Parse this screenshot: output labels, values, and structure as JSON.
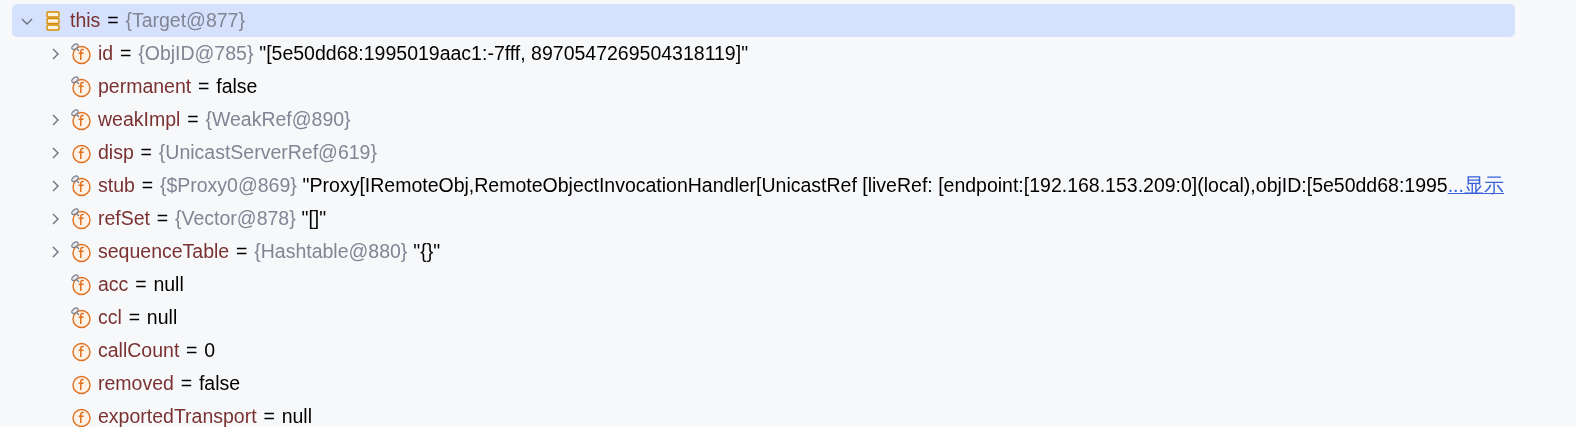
{
  "tree": {
    "name": "this",
    "eq": "=",
    "type": "{Target@877}",
    "kind": "object",
    "expanded": true,
    "selected": true,
    "children": [
      {
        "name": "id",
        "type": "{ObjID@785}",
        "value": "\"[5e50dd68:1995019aac1:-7fff, 8970547269504318119]\"",
        "kind": "field",
        "final": true,
        "expandable": true,
        "expanded": false
      },
      {
        "name": "permanent",
        "value": "false",
        "kind": "field",
        "final": true,
        "expandable": false
      },
      {
        "name": "weakImpl",
        "type": "{WeakRef@890}",
        "kind": "field",
        "final": true,
        "expandable": true,
        "expanded": false
      },
      {
        "name": "disp",
        "type": "{UnicastServerRef@619}",
        "kind": "field",
        "final": false,
        "expandable": true,
        "expanded": false
      },
      {
        "name": "stub",
        "type": "{$Proxy0@869}",
        "value": "\"Proxy[IRemoteObj,RemoteObjectInvocationHandler[UnicastRef [liveRef: [endpoint:[192.168.153.209:0](local),objID:[5e50dd68:1995",
        "more_link": "...显示",
        "kind": "field",
        "final": true,
        "expandable": true,
        "expanded": false
      },
      {
        "name": "refSet",
        "type": "{Vector@878}",
        "value": "\"[]\"",
        "kind": "field",
        "final": true,
        "expandable": true,
        "expanded": false
      },
      {
        "name": "sequenceTable",
        "type": "{Hashtable@880}",
        "value": "\"{}\"",
        "kind": "field",
        "final": true,
        "expandable": true,
        "expanded": false
      },
      {
        "name": "acc",
        "value": "null",
        "kind": "field",
        "final": true,
        "expandable": false
      },
      {
        "name": "ccl",
        "value": "null",
        "kind": "field",
        "final": true,
        "expandable": false
      },
      {
        "name": "callCount",
        "value": "0",
        "kind": "field",
        "final": false,
        "expandable": false
      },
      {
        "name": "removed",
        "value": "false",
        "kind": "field",
        "final": false,
        "expandable": false
      },
      {
        "name": "exportedTransport",
        "value": "null",
        "kind": "field",
        "final": false,
        "expandable": false
      }
    ]
  }
}
